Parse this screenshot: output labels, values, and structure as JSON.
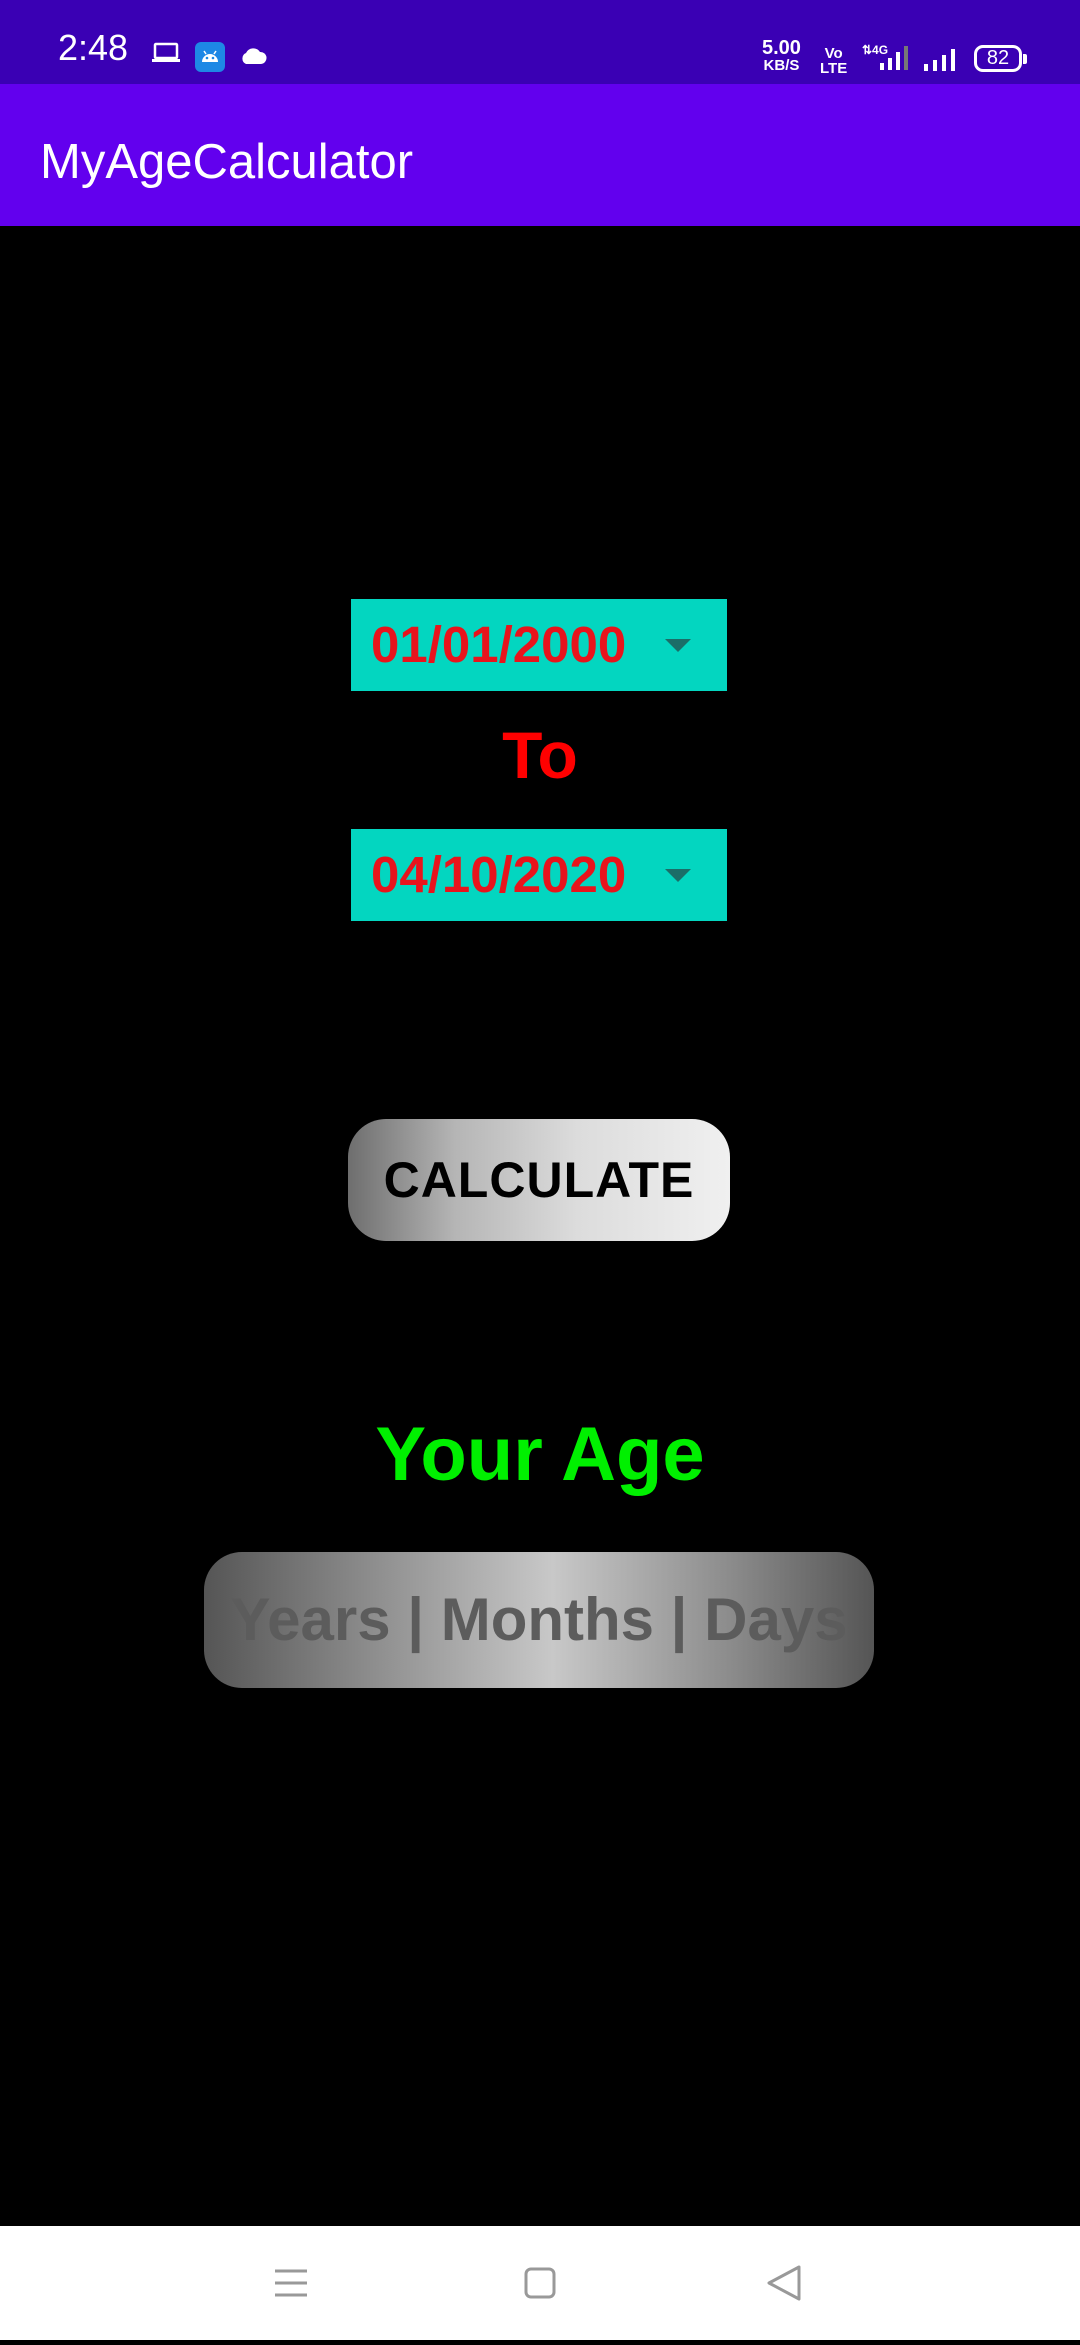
{
  "status_bar": {
    "time": "2:48",
    "net_speed_value": "5.00",
    "net_speed_unit": "KB/S",
    "volte_top": "Vo",
    "volte_bottom": "LTE",
    "network_type": "4G",
    "battery": "82",
    "icons": [
      "laptop-icon",
      "android-icon",
      "cloud-icon",
      "signal-icon",
      "battery-icon"
    ]
  },
  "app_bar": {
    "title": "MyAgeCalculator"
  },
  "form": {
    "from_date": "01/01/2000",
    "to_label": "To",
    "to_date": "04/10/2020",
    "calculate_label": "CALCULATE"
  },
  "result": {
    "heading": "Your Age",
    "value": "Years | Months | Days"
  },
  "colors": {
    "status_bar": "#3a00b4",
    "app_bar": "#6200ee",
    "date_picker_bg": "#03d6c0",
    "date_text": "#e8141c",
    "to_text": "#ff0000",
    "age_heading": "#00f000",
    "background": "#000000"
  },
  "nav_bar": {
    "icons": [
      "menu-icon",
      "home-icon",
      "back-icon"
    ]
  }
}
